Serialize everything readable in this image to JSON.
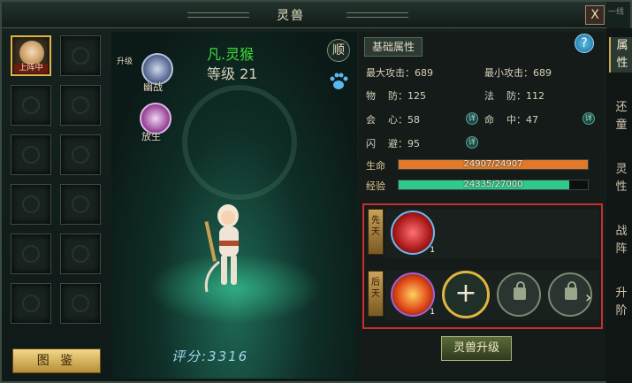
{
  "window": {
    "title": "灵兽",
    "close_label": "X",
    "top_right_text": "一线"
  },
  "slots": {
    "active_tag": "上阵中",
    "atlas_button": "图 鉴"
  },
  "stage": {
    "pet_name": "凡.灵猴",
    "level": "等级 21",
    "tame_badge": "顺",
    "orb_top_label": "幽战",
    "orb_top_small": "升级",
    "orb_bottom_label": "放生",
    "score": "评分:3316"
  },
  "attributes": {
    "tab_label": "基础属性",
    "help": "?",
    "max_attack": "最大攻击：689",
    "min_attack": "最小攻击：689",
    "phys_def": "物    防：125",
    "magic_def": "法    防：112",
    "crit": "会    心：58",
    "hit": "命    中：47",
    "dodge": "闪    避：95",
    "detail_icon": "详",
    "hp_label": "生命",
    "hp_text": "24907/24907",
    "hp_fraction": 1.0,
    "exp_label": "经验",
    "exp_text": "24335/27000",
    "exp_fraction": 0.9013,
    "hp_color": "#e07a2a",
    "exp_color": "#2ecb8a"
  },
  "skills": {
    "innate_tag": "先天",
    "acquired_tag": "后天",
    "innate_count": "1",
    "acquired_count": "1",
    "add_symbol": "+",
    "more_arrow": "›"
  },
  "upgrade_button": "灵兽升级",
  "side_tabs": [
    "属性",
    "还童",
    "灵性",
    "战阵",
    "升阶"
  ]
}
